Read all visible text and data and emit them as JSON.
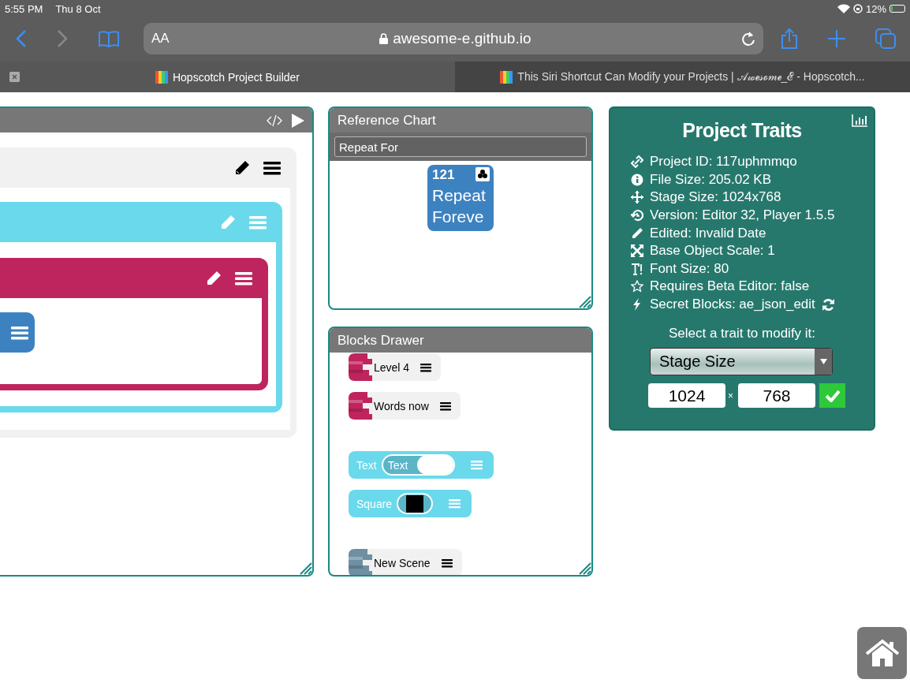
{
  "status_bar": {
    "time": "5:55 PM",
    "date": "Thu 8 Oct",
    "battery": "12%"
  },
  "browser": {
    "text_size": "AA",
    "url": "awesome-e.github.io"
  },
  "tabs": [
    {
      "title": "Hopscotch Project Builder",
      "selected": true
    },
    {
      "title": "This Siri Shortcut Can Modify your Projects | 𝒜𝓌ℯ𝓈ℴ𝓂ℯ_ℰ - Hopscotch...",
      "selected": false
    }
  ],
  "reference_chart": {
    "title": "Reference Chart",
    "search_value": "Repeat For",
    "block": {
      "number": "121",
      "label_lines": [
        "Repeat",
        "Foreve"
      ]
    }
  },
  "blocks_drawer": {
    "title": "Blocks Drawer",
    "groups": [
      {
        "items": [
          {
            "kind": "rule",
            "label": "Level 4",
            "color": "#c0245d"
          },
          {
            "kind": "rule",
            "label": "Words now",
            "color": "#c0245d"
          }
        ]
      },
      {
        "items": [
          {
            "kind": "text-object",
            "label": "Text",
            "value": "Text"
          },
          {
            "kind": "shape-object",
            "label": "Square"
          }
        ]
      },
      {
        "items": [
          {
            "kind": "rule",
            "label": "New Scene",
            "color": "#6f8fa3"
          }
        ]
      }
    ]
  },
  "project_traits": {
    "title": "Project Traits",
    "traits": [
      {
        "kind": "link",
        "text": "Project ID: 117uphmmqo"
      },
      {
        "kind": "info",
        "text": "File Size: 205.02 KB"
      },
      {
        "kind": "move",
        "text": "Stage Size: 1024x768"
      },
      {
        "kind": "history",
        "text": "Version: Editor 32, Player 1.5.5"
      },
      {
        "kind": "pencil",
        "text": "Edited: Invalid Date"
      },
      {
        "kind": "expand",
        "text": "Base Object Scale: 1"
      },
      {
        "kind": "font",
        "text": "Font Size: 80"
      },
      {
        "kind": "star",
        "text": "Requires Beta Editor: false"
      },
      {
        "kind": "bolt",
        "text": "Secret Blocks: ae_json_edit",
        "refresh": true
      }
    ],
    "prompt": "Select a trait to modify it:",
    "selected_trait": "Stage Size",
    "width_value": "1024",
    "separator": "×",
    "height_value": "768"
  }
}
